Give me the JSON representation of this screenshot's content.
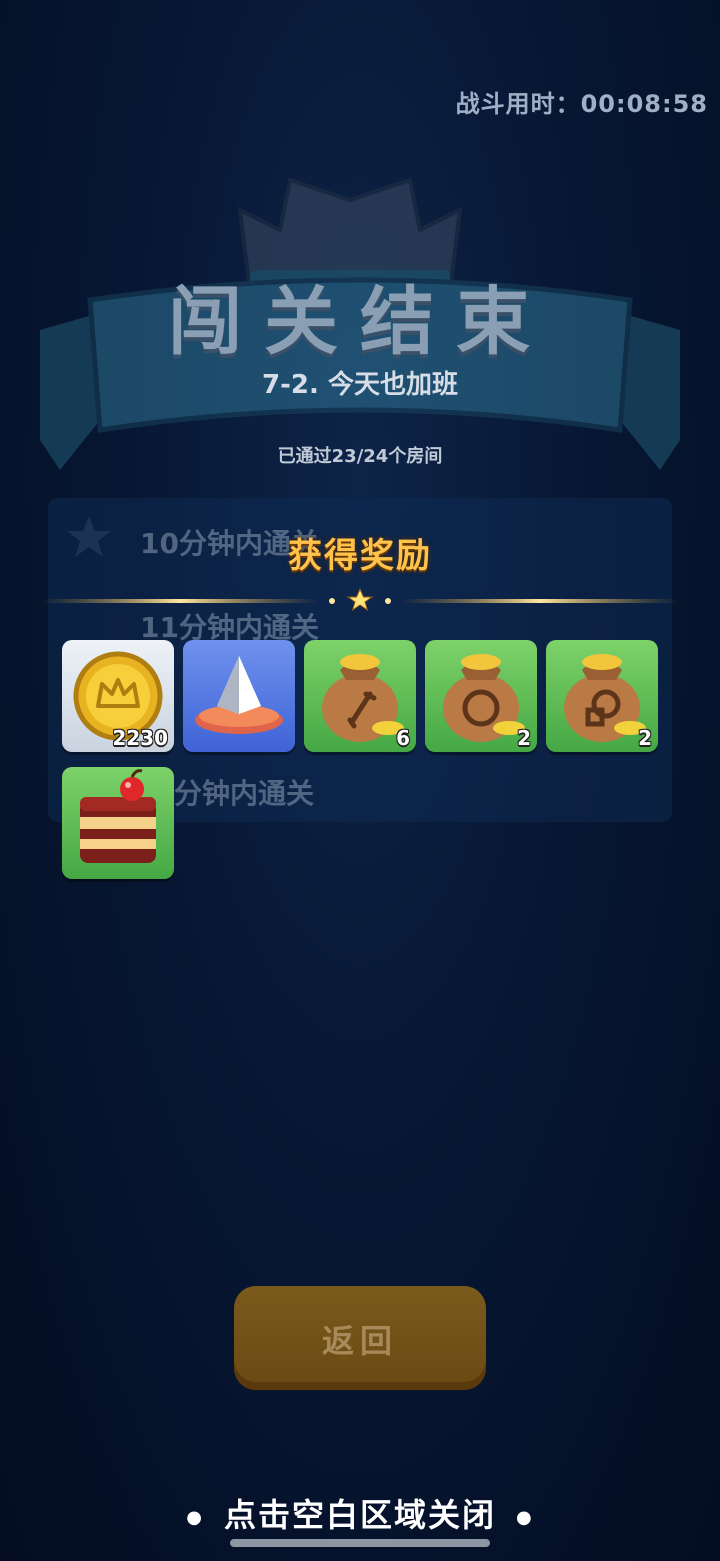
{
  "battle_timer": {
    "label": "战斗用时：",
    "value": "00:08:58"
  },
  "banner": {
    "title": "闯关结束",
    "level_name": "7-2. 今天也加班",
    "rooms_passed": "已通过23/24个房间"
  },
  "goals": [
    {
      "label": "10分钟内通关"
    },
    {
      "label": "11分钟内通关"
    },
    {
      "label": "分钟内通关"
    }
  ],
  "rewards_title": "获得奖励",
  "rewards": [
    {
      "icon": "gold-coin-icon",
      "count": "2230"
    },
    {
      "icon": "crystal-on-cushion-icon",
      "count": ""
    },
    {
      "icon": "sword-loot-bag-icon",
      "count": "6"
    },
    {
      "icon": "shield-loot-bag-icon",
      "count": "2"
    },
    {
      "icon": "ring-loot-bag-icon",
      "count": "2"
    },
    {
      "icon": "cake-icon",
      "count": ""
    }
  ],
  "back_button": "返回",
  "close_hint": "点击空白区域关闭",
  "colors": {
    "accent": "#ffc24a",
    "background": "#071733",
    "button": "#6a4a12"
  }
}
